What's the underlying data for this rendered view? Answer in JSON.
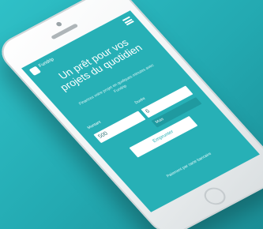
{
  "brand": {
    "name": "Fundrip"
  },
  "hero": {
    "headline": "Un prêt pour vos projets du quotidien",
    "subtext": "Financez votre projet en quelques minutes avec Fundrip"
  },
  "form": {
    "amount_label": "Montant",
    "amount_value": "500",
    "duration_label": "Durée",
    "duration_value": "6",
    "unit_label": "Mois",
    "submit_label": "Emprunter"
  },
  "footer": {
    "link_text": "Paiement par carte bancaire"
  }
}
